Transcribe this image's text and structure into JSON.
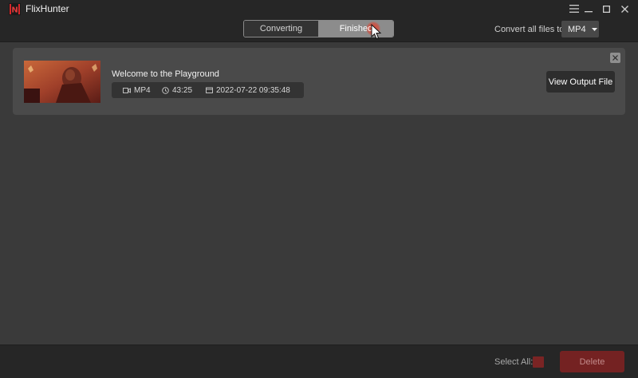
{
  "app": {
    "title": "FlixHunter",
    "logo_letter": "N",
    "brand_color": "#d9262a"
  },
  "tabs": [
    {
      "label": "Converting",
      "active": false
    },
    {
      "label": "Finished",
      "active": true
    }
  ],
  "toolbar": {
    "convert_label": "Convert all files to:",
    "format_value": "MP4"
  },
  "item": {
    "title": "Welcome to the Playground",
    "format": "MP4",
    "duration": "43:25",
    "date": "2022-07-22 09:35:48",
    "view_button": "View Output File"
  },
  "footer": {
    "select_all_label": "Select All:",
    "delete_label": "Delete"
  },
  "icons": [
    "menu-icon",
    "minimize-icon",
    "maximize-icon",
    "close-icon",
    "video-icon",
    "clock-icon",
    "calendar-icon",
    "caret-down-icon",
    "cursor-icon"
  ],
  "colors": {
    "accent_red": "#7a2424",
    "delete_bg": "#742222",
    "app_bg": "#3a3a3a",
    "chrome_bg": "#262626"
  }
}
